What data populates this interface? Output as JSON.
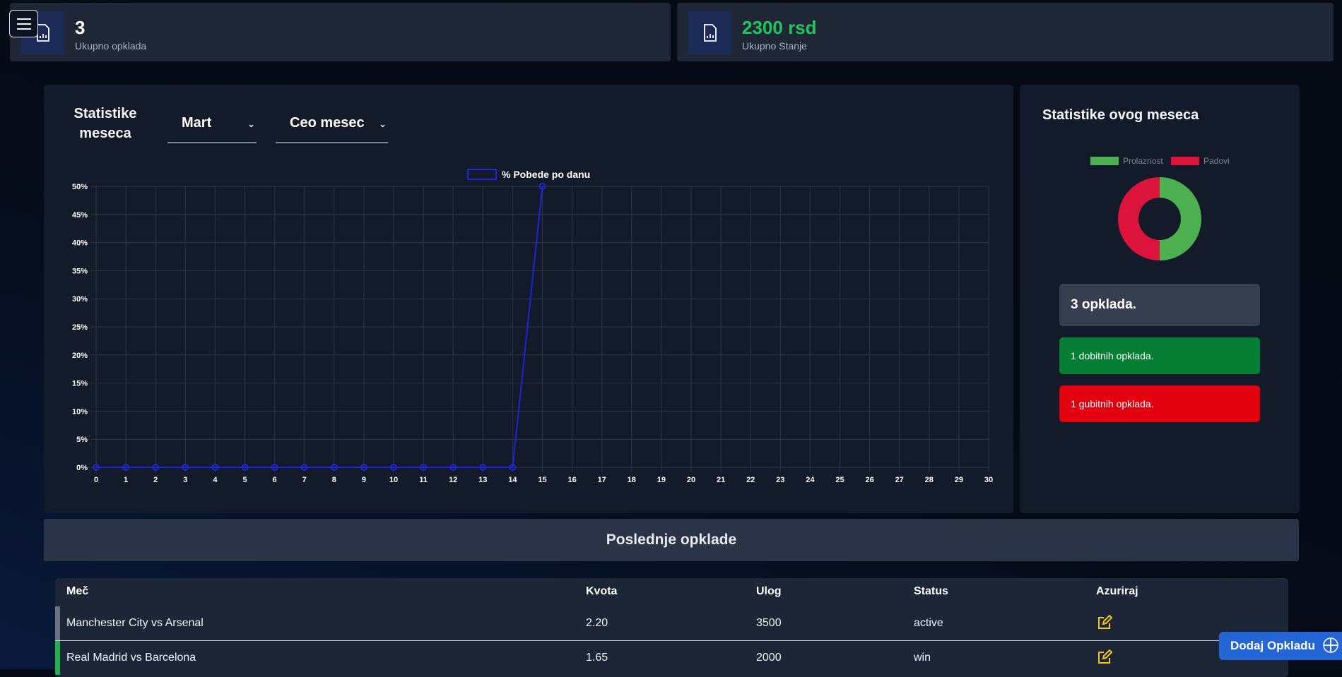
{
  "stats": [
    {
      "value": "3",
      "label": "Ukupno opklada",
      "icon": "report-icon",
      "value_color": "#ffffff"
    },
    {
      "value": "2300 rsd",
      "label": "Ukupno Stanje",
      "icon": "report-icon",
      "value_color": "#1fc75c"
    }
  ],
  "chart_panel": {
    "title": "Statistike meseca",
    "month_select": "Mart",
    "period_select": "Ceo mesec"
  },
  "chart_data": {
    "type": "line",
    "series": [
      {
        "name": "% Pobede po danu",
        "color": "#1d25d6",
        "x": [
          0,
          1,
          2,
          3,
          4,
          5,
          6,
          7,
          8,
          9,
          10,
          11,
          12,
          13,
          14,
          15
        ],
        "values": [
          0,
          0,
          0,
          0,
          0,
          0,
          0,
          0,
          0,
          0,
          0,
          0,
          0,
          0,
          0,
          50
        ]
      }
    ],
    "x_ticks": [
      "0",
      "1",
      "2",
      "3",
      "4",
      "5",
      "6",
      "7",
      "8",
      "9",
      "10",
      "11",
      "12",
      "13",
      "14",
      "15",
      "16",
      "17",
      "18",
      "19",
      "20",
      "21",
      "22",
      "23",
      "24",
      "25",
      "26",
      "27",
      "28",
      "29",
      "30"
    ],
    "y_ticks": [
      "0%",
      "5%",
      "10%",
      "15%",
      "20%",
      "25%",
      "30%",
      "35%",
      "40%",
      "45%",
      "50%"
    ],
    "xlim": [
      0,
      30
    ],
    "ylim": [
      0,
      50
    ],
    "grid": true,
    "legend": "top"
  },
  "side_panel": {
    "title": "Statistike ovog meseca",
    "donut": {
      "type": "pie",
      "labels": [
        "Prolaznost",
        "Padovi"
      ],
      "values": [
        1,
        1
      ],
      "colors": [
        "#4caf50",
        "#dc143c"
      ]
    },
    "total_text": "3 opklada.",
    "wins_text": "1 dobitnih opklada.",
    "losses_text": "1 gubitnih opklada.",
    "colors": {
      "total": "#353f4f",
      "wins": "#067e34",
      "losses": "#e3000f"
    }
  },
  "bets": {
    "title": "Poslednje opklade",
    "columns": [
      "Meč",
      "Kvota",
      "Ulog",
      "Status",
      "Azuriraj"
    ],
    "rows": [
      {
        "match": "Manchester City vs Arsenal",
        "odds": "2.20",
        "stake": "3500",
        "status": "active",
        "status_color": "#6c7380"
      },
      {
        "match": "Real Madrid vs Barcelona",
        "odds": "1.65",
        "stake": "2000",
        "status": "win",
        "status_color": "#22b14c"
      }
    ],
    "edit_icon": "edit-icon",
    "edit_color": "#f5c518"
  },
  "add_button": {
    "label": "Dodaj Opkladu",
    "icon": "plus-icon"
  }
}
